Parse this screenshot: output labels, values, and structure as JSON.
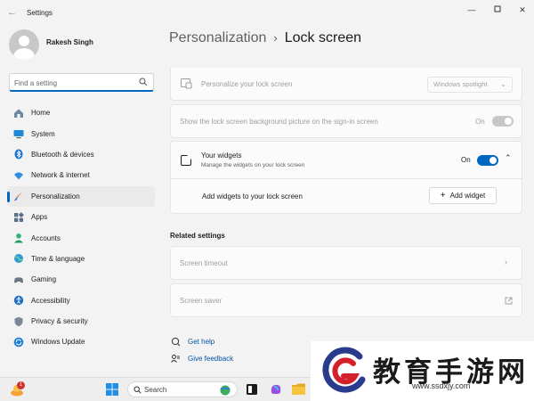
{
  "window": {
    "title": "Settings"
  },
  "profile": {
    "name": "Rakesh Singh"
  },
  "search": {
    "placeholder": "Find a setting"
  },
  "sidebar": {
    "items": [
      {
        "label": "Home",
        "icon": "home-icon",
        "active": false
      },
      {
        "label": "System",
        "icon": "system-monitor-icon",
        "active": false
      },
      {
        "label": "Bluetooth & devices",
        "icon": "bluetooth-icon",
        "active": false
      },
      {
        "label": "Network & internet",
        "icon": "wifi-icon",
        "active": false
      },
      {
        "label": "Personalization",
        "icon": "paintbrush-icon",
        "active": true
      },
      {
        "label": "Apps",
        "icon": "apps-icon",
        "active": false
      },
      {
        "label": "Accounts",
        "icon": "accounts-icon",
        "active": false
      },
      {
        "label": "Time & language",
        "icon": "globe-clock-icon",
        "active": false
      },
      {
        "label": "Gaming",
        "icon": "gamepad-icon",
        "active": false
      },
      {
        "label": "Accessibility",
        "icon": "accessibility-icon",
        "active": false
      },
      {
        "label": "Privacy & security",
        "icon": "shield-icon",
        "active": false
      },
      {
        "label": "Windows Update",
        "icon": "windows-update-icon",
        "active": false
      }
    ]
  },
  "header": {
    "breadcrumb_parent": "Personalization",
    "separator": "›",
    "title": "Lock screen"
  },
  "lock_screen": {
    "personalize": {
      "label": "Personalize your lock screen",
      "value": "Windows spotlight",
      "enabled": false
    },
    "show_background": {
      "label": "Show the lock screen background picture on the sign-in screen",
      "state": "On",
      "enabled": false
    },
    "widgets": {
      "label": "Your widgets",
      "description": "Manage the widgets on your lock screen",
      "state": "On",
      "add_label": "Add widgets to your lock screen",
      "add_button": "Add widget"
    }
  },
  "related": {
    "heading": "Related settings",
    "items": [
      {
        "label": "Screen timeout",
        "icon": "chevron-right-icon"
      },
      {
        "label": "Screen saver",
        "icon": "external-link-icon"
      }
    ]
  },
  "help": {
    "get_help": "Get help",
    "give_feedback": "Give feedback"
  },
  "taskbar": {
    "search_placeholder": "Search",
    "notification_count": "1"
  },
  "watermark": {
    "chinese_text": "教育手游网",
    "url": "www.ssdxjy.com"
  },
  "colors": {
    "accent": "#0067c0",
    "background": "#f3f3f3",
    "card": "#fbfbfb"
  }
}
